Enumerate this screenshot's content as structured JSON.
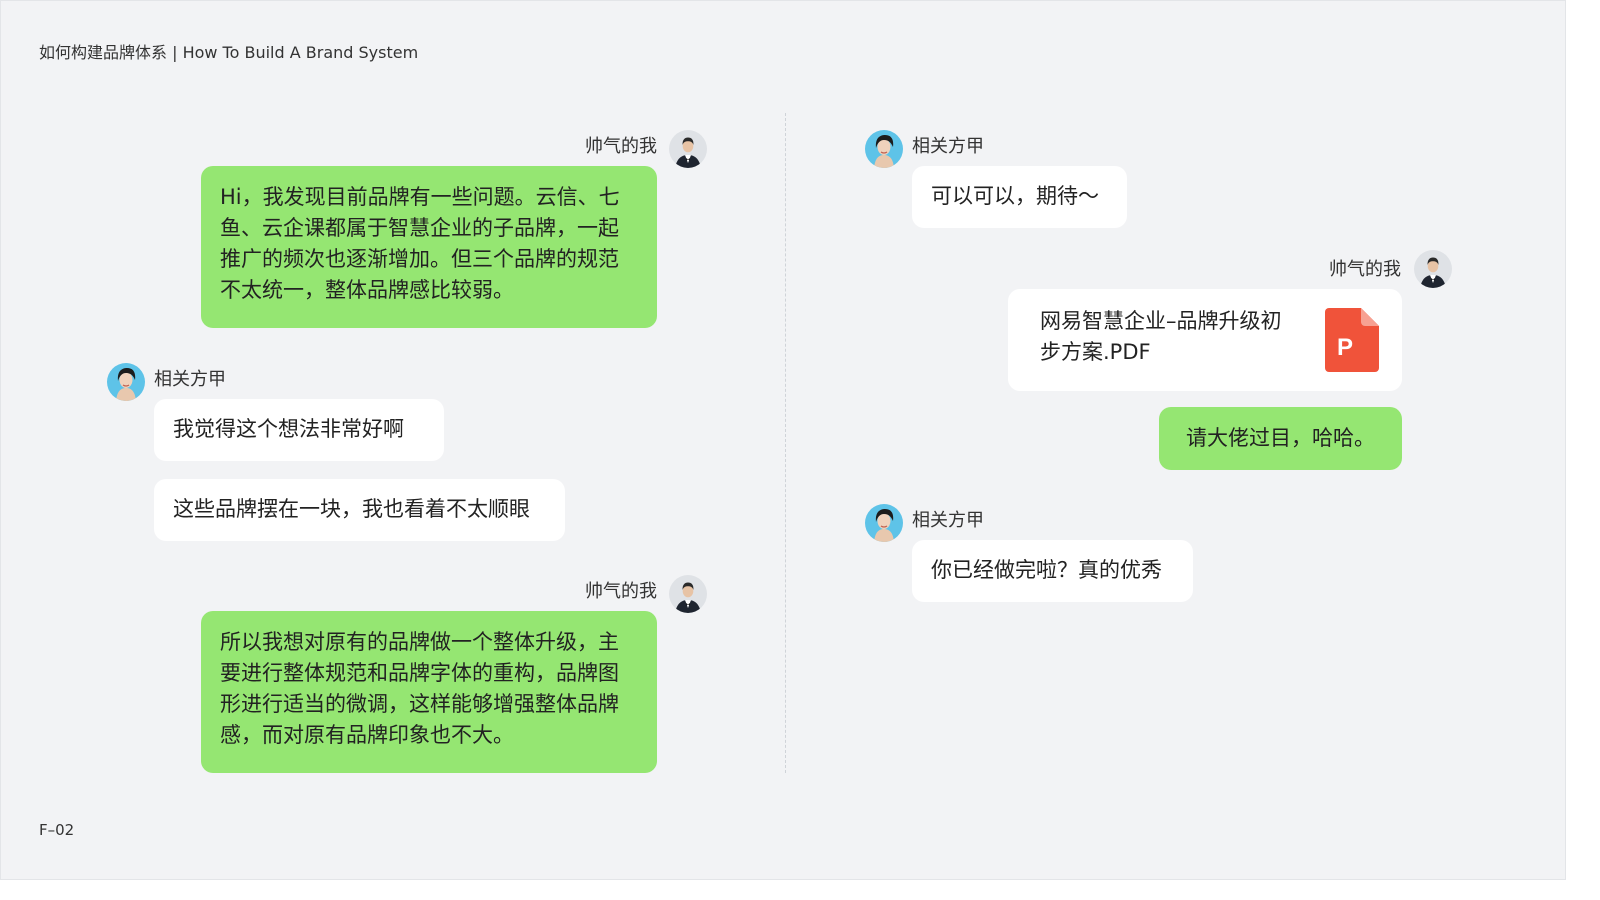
{
  "header": {
    "title": "如何构建品牌体系 | How To Build A Brand System"
  },
  "footer": {
    "code": "F–02"
  },
  "users": {
    "me": "帅气的我",
    "other": "相关方甲"
  },
  "left_column": {
    "msg1": "Hi，我发现目前品牌有一些问题。云信、七鱼、云企课都属于智慧企业的子品牌，一起推广的频次也逐渐增加。但三个品牌的规范不太统一，整体品牌感比较弱。",
    "msg2": "我觉得这个想法非常好啊",
    "msg3": "这些品牌摆在一块，我也看着不太顺眼",
    "msg4": "所以我想对原有的品牌做一个整体升级，主要进行整体规范和品牌字体的重构，品牌图形进行适当的微调，这样能够增强整体品牌感，而对原有品牌印象也不大。"
  },
  "right_column": {
    "msg1": "可以可以，期待～",
    "file_name": "网易智慧企业–品牌升级初步方案.PDF",
    "file_icon_letter": "P",
    "msg2": "请大佬过目，哈哈。",
    "msg3": "你已经做完啦？真的优秀"
  },
  "colors": {
    "background": "#f2f3f5",
    "bubble_me": "#95e672",
    "bubble_other": "#ffffff",
    "pdf_icon": "#f0533a"
  }
}
